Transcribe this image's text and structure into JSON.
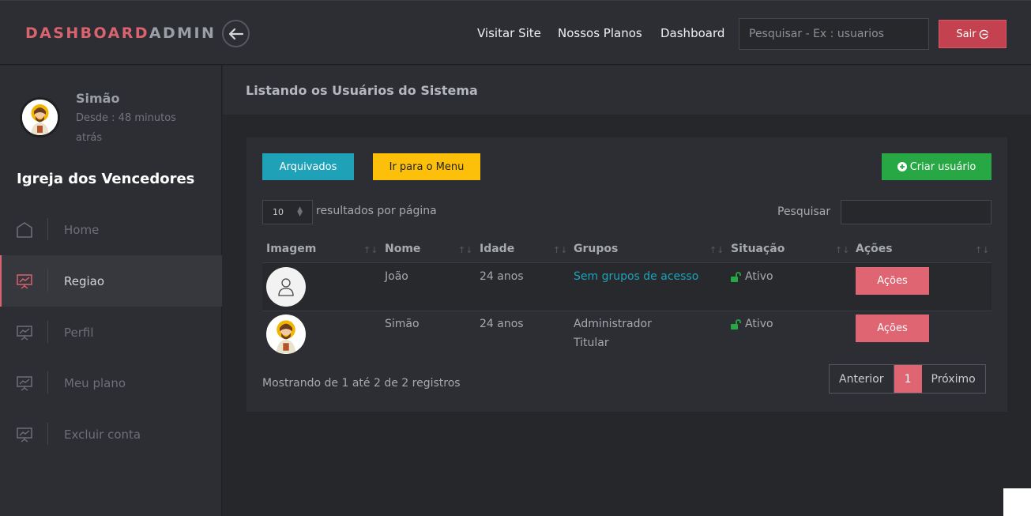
{
  "header": {
    "brand_part1": "DASHBOARD",
    "brand_part2": "ADMIN",
    "nav": [
      "Visitar Site",
      "Nossos Planos",
      "Dashboard"
    ],
    "search_placeholder": "Pesquisar - Ex : usuarios",
    "logout_label": "Sair"
  },
  "sidebar": {
    "user_name": "Simão",
    "user_since": "Desde : 48 minutos atrás",
    "church": "Igreja dos Vencedores",
    "items": [
      {
        "label": "Home",
        "icon": "home-icon"
      },
      {
        "label": "Regiao",
        "icon": "presentation-chart-icon"
      },
      {
        "label": "Perfil",
        "icon": "presentation-chart-icon"
      },
      {
        "label": "Meu plano",
        "icon": "presentation-chart-icon"
      },
      {
        "label": "Excluir conta",
        "icon": "presentation-chart-icon"
      }
    ],
    "active_index": 1
  },
  "main": {
    "title": "Listando os Usuários do Sistema",
    "buttons": {
      "archived": "Arquivados",
      "menu": "Ir para o Menu",
      "create": "Criar usuário"
    },
    "page_length": "10",
    "page_length_label": "resultados por página",
    "filter_label": "Pesquisar",
    "columns": [
      "Imagem",
      "Nome",
      "Idade",
      "Grupos",
      "Situação",
      "Ações"
    ],
    "rows": [
      {
        "name": "João",
        "age": "24 anos",
        "groups": [
          "Sem grupos de acesso"
        ],
        "status": "Ativo",
        "action": "Ações"
      },
      {
        "name": "Simão",
        "age": "24 anos",
        "groups": [
          "Administrador",
          "Titular"
        ],
        "status": "Ativo",
        "action": "Ações"
      }
    ],
    "info": "Mostrando de 1 até 2 de 2 registros",
    "pagination": {
      "prev": "Anterior",
      "current": "1",
      "next": "Próximo"
    }
  },
  "colors": {
    "accent": "#d9636f",
    "info": "#1fa2b8",
    "warning": "#fcc00a",
    "success": "#27a844",
    "danger": "#c4424f"
  }
}
